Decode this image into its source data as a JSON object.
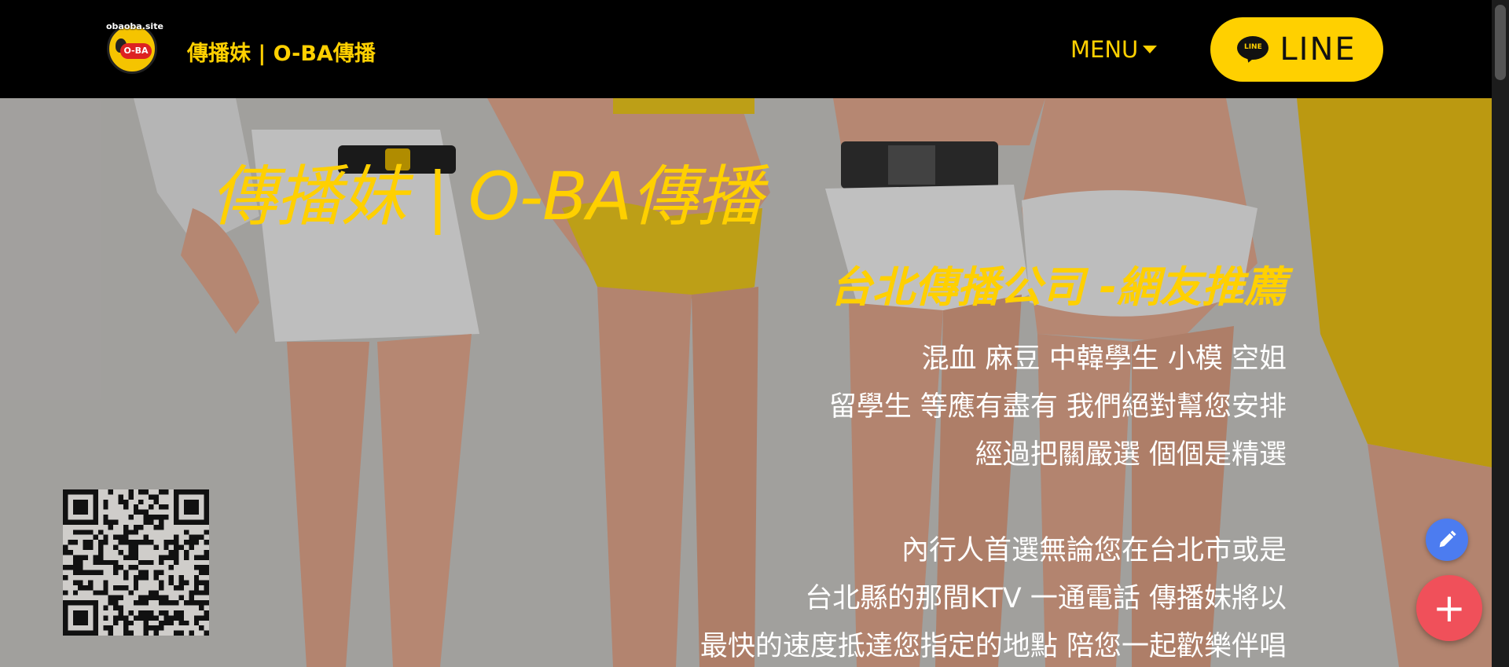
{
  "header": {
    "logo_text": "obaoba.site",
    "logo_badge": "O-BA",
    "brand": "傳播妹 | O-BA傳播",
    "menu_label": "MENU",
    "line_button": {
      "icon_text": "LINE",
      "label": "LINE"
    }
  },
  "hero": {
    "title": "傳播妹 | O-BA傳播",
    "subtitle": "台北傳播公司 -網友推薦",
    "lines_group1": [
      "混血 麻豆 中韓學生 小模 空姐",
      "留學生 等應有盡有 我們絕對幫您安排",
      "經過把關嚴選 個個是精選"
    ],
    "lines_group2": [
      "內行人首選無論您在台北市或是",
      "台北縣的那間KTV 一通電話 傳播妹將以",
      "最快的速度抵達您指定的地點  陪您一起歡樂伴唱"
    ]
  },
  "floating": {
    "edit_icon": "pencil-icon",
    "add_label": "+"
  },
  "colors": {
    "header_bg": "#000000",
    "accent_yellow": "#ffd000",
    "fab_blue": "#4c7cf0",
    "fab_red": "#f0505a"
  }
}
